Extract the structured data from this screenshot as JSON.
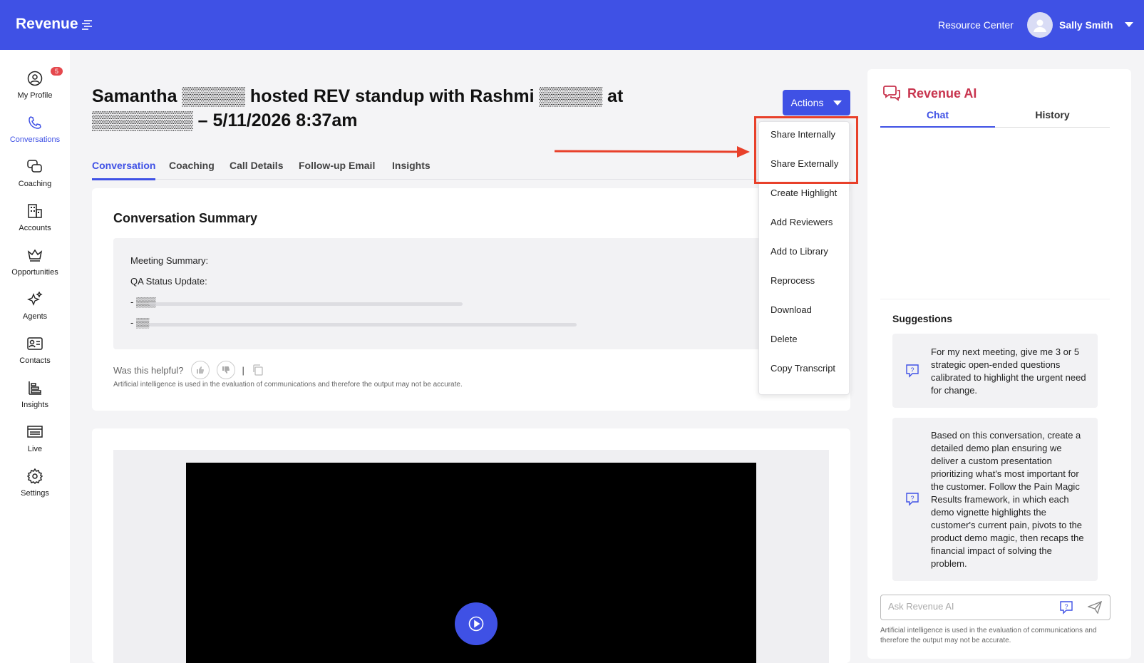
{
  "header": {
    "brand": "Revenue",
    "resource_center": "Resource Center",
    "user_name": "Sally Smith"
  },
  "sidebar": {
    "profile_badge": "5",
    "items": [
      {
        "label": "My Profile",
        "icon": "user-circle-icon"
      },
      {
        "label": "Conversations",
        "icon": "phone-icon"
      },
      {
        "label": "Coaching",
        "icon": "chat-bubbles-icon"
      },
      {
        "label": "Accounts",
        "icon": "building-icon"
      },
      {
        "label": "Opportunities",
        "icon": "crown-icon"
      },
      {
        "label": "Agents",
        "icon": "sparkles-icon"
      },
      {
        "label": "Contacts",
        "icon": "contact-card-icon"
      },
      {
        "label": "Insights",
        "icon": "bar-chart-icon"
      },
      {
        "label": "Live",
        "icon": "live-icon"
      },
      {
        "label": "Settings",
        "icon": "gear-icon"
      }
    ]
  },
  "page": {
    "title": "Samantha ▒▒▒▒▒ hosted REV standup with Rashmi ▒▒▒▒▒ at ▒▒▒▒▒▒▒▒ – 5/11/2026 8:37am",
    "actions_label": "Actions",
    "tabs": [
      "Conversation",
      "Coaching",
      "Call Details",
      "Follow-up Email",
      "Insights"
    ]
  },
  "summary": {
    "heading": "Conversation Summary",
    "lines": [
      "Meeting Summary:",
      "QA Status Update:",
      "- ▒▒▒",
      "- ▒▒"
    ],
    "helpful_label": "Was this helpful?",
    "disclaimer": "Artificial intelligence is used in the evaluation of communications and therefore the output may not be accurate."
  },
  "dropdown": {
    "items": [
      "Share Internally",
      "Share Externally",
      "Create Highlight",
      "Add Reviewers",
      "Add to Library",
      "Reprocess",
      "Download",
      "Delete",
      "Copy Transcript"
    ]
  },
  "ai_panel": {
    "title": "Revenue AI",
    "tabs": [
      "Chat",
      "History"
    ],
    "suggestions_title": "Suggestions",
    "suggestions": [
      "For my next meeting, give me 3 or 5 strategic open-ended questions calibrated to highlight the urgent need for change.",
      "Based on this conversation, create a detailed demo plan ensuring we deliver a custom presentation prioritizing what's most important for the customer. Follow the Pain Magic Results framework, in which each demo vignette highlights the customer's current pain, pivots to the product demo magic, then recaps the financial impact of solving the problem."
    ],
    "input_placeholder": "Ask Revenue AI",
    "disclaimer": "Artificial intelligence is used in the evaluation of communications and therefore the output may not be accurate."
  },
  "colors": {
    "brand": "#3f51e5",
    "ai_accent": "#c8344e",
    "annotation": "#e8402a"
  }
}
